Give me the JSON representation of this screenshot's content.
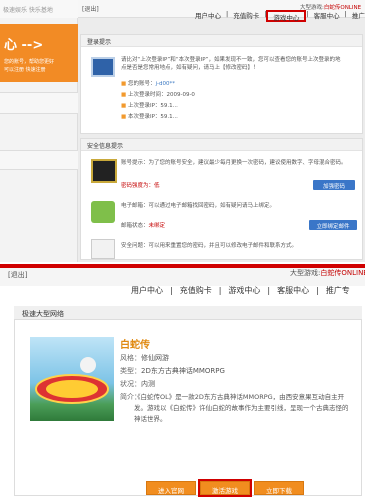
{
  "top": {
    "brand": "极速娱乐 快乐基地",
    "logout": "[退出]",
    "game_label": "大型游戏:",
    "game_name": "白蛇传ONLINE",
    "nav": [
      "用户中心",
      "充值购卡",
      "游戏中心",
      "客服中心",
      "推广专区"
    ],
    "active_nav": "游戏中心",
    "sidebar_title": "心 -->",
    "sidebar_lines": [
      "您的账号，帮助您更好",
      "可以注册 快速注册"
    ],
    "login_panel": {
      "title": "登录提示",
      "line1": "请比对“上次登录IP”和“本次登录IP”，如果发现不一致，您可以查看您的账号上次登录的地",
      "line2": "点是否是您常用地点，如有疑问，请马上【修改密码】！",
      "items": [
        {
          "label": "您的账号：",
          "value": "j-d00**"
        },
        {
          "label": "上次登录时间：",
          "value": "2009-09-0"
        },
        {
          "label": "上次登录IP：",
          "value": "59.1..."
        },
        {
          "label": "本次登录IP：",
          "value": "59.1..."
        }
      ]
    },
    "security_panel": {
      "title": "安全信息提示",
      "account_tip": "账号提示：为了您的账号安全，建议最少每月更换一次密码，建议使用数字、字母混合密码。",
      "pwd_label": "密码强度为：",
      "pwd_value": "低",
      "pwd_button": "加强密码",
      "email_tip": "电子邮箱：可以通过电子邮箱找回密码，如有疑问请马上绑定。",
      "bind_label": "邮箱状态：",
      "bind_value": "未绑定",
      "bind_button": "立即绑定邮件",
      "qa_tip": "安全问题：可以用来重置您的密码，并且可以修改电子邮件和联系方式。"
    }
  },
  "bottom": {
    "logout": "[退出]",
    "game_label": "大型游戏:",
    "game_name": "白蛇传ONLINE",
    "nav": [
      "用户中心",
      "充值购卡",
      "游戏中心",
      "客服中心",
      "推广专"
    ],
    "panel_title": "极速大型网络",
    "game": {
      "title": "白蛇传",
      "style_label": "风格：",
      "style_value": "修仙网游",
      "type_label": "类型：",
      "type_value": "2D东方古典神话MMORPG",
      "status_label": "状况：",
      "status_value": "内测",
      "intro_label": "简介：",
      "intro_value": "《白蛇传OL》是一款2D东方古典神话MMORPG，由西安意果互动自主开发。游戏以《白蛇传》许仙白蛇的故事作为主要引线，呈现一个古典志怪的神话世界。"
    },
    "buttons": [
      "进入官网",
      "激活游戏",
      "立即下载"
    ]
  }
}
